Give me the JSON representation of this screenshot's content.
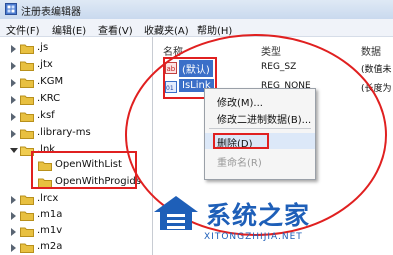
{
  "window": {
    "title": "注册表编辑器"
  },
  "menu": [
    {
      "label": "文件(F)"
    },
    {
      "label": "编辑(E)"
    },
    {
      "label": "查看(V)"
    },
    {
      "label": "收藏夹(A)"
    },
    {
      "label": "帮助(H)"
    }
  ],
  "tree": {
    "items": [
      {
        "label": ".js",
        "expander": true
      },
      {
        "label": ".jtx",
        "expander": true
      },
      {
        "label": ".KGM",
        "expander": true
      },
      {
        "label": ".KRC",
        "expander": true
      },
      {
        "label": ".ksf",
        "expander": true
      },
      {
        "label": ".library-ms",
        "expander": true
      },
      {
        "label": ".lnk",
        "expander": true,
        "expanded": true
      },
      {
        "label": "OpenWithList",
        "expander": false,
        "child": true
      },
      {
        "label": "OpenWithProgids",
        "expander": false,
        "child": true
      },
      {
        "label": ".lrcx",
        "expander": true
      },
      {
        "label": ".m1a",
        "expander": true
      },
      {
        "label": ".m1v",
        "expander": true
      },
      {
        "label": ".m2a",
        "expander": true
      }
    ]
  },
  "columns": {
    "name": "名称",
    "type": "类型",
    "data": "数据"
  },
  "values": [
    {
      "name": "(默认)",
      "type": "REG_SZ",
      "data": "(数值未"
    },
    {
      "name": "IsLink",
      "type": "REG_NONE",
      "data": "(长度为"
    }
  ],
  "context_menu": {
    "items": [
      {
        "label": "修改(M)..."
      },
      {
        "label": "修改二进制数据(B)..."
      },
      {
        "label": "删除(D)",
        "highlighted": true
      },
      {
        "label": "重命名(R)",
        "disabled": true
      }
    ]
  },
  "watermark": {
    "text": "系统之家",
    "url": "XITONGZHIJIA.NET"
  },
  "colors": {
    "highlight": "#e02020",
    "folder": "#e8c040",
    "selection": "#3b6fc8",
    "title_bg": "#dfe9f5"
  }
}
